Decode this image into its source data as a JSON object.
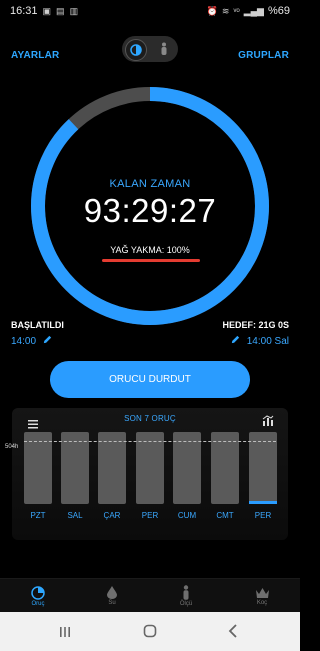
{
  "status": {
    "time": "16:31",
    "battery": "%69"
  },
  "header": {
    "left_link": "AYARLAR",
    "right_link": "GRUPLAR"
  },
  "timer": {
    "label": "KALAN ZAMAN",
    "value": "93:29:27",
    "fat_burn": "YAĞ YAKMA: 100%",
    "ring_progress": 0.88
  },
  "start": {
    "title": "BAŞLATILDI",
    "time": "14:00"
  },
  "goal": {
    "title": "HEDEF: 21G 0S",
    "time": "14:00 Sal"
  },
  "stop_button": "ORUCU DURDUT",
  "history": {
    "title": "SON 7 ORUÇ",
    "goal_label": "504h",
    "days": [
      "PZT",
      "SAL",
      "ÇAR",
      "PER",
      "CUM",
      "CMT",
      "PER"
    ]
  },
  "nav": {
    "items": [
      {
        "label": "Oruç",
        "icon": "fasting-timer-icon"
      },
      {
        "label": "Su",
        "icon": "water-drop-icon"
      },
      {
        "label": "Ölçü",
        "icon": "person-icon"
      },
      {
        "label": "Koç",
        "icon": "crown-icon"
      }
    ]
  },
  "colors": {
    "accent": "#2a9cff",
    "ring_track": "#4d4d4d",
    "fat_line": "#e53c31"
  }
}
